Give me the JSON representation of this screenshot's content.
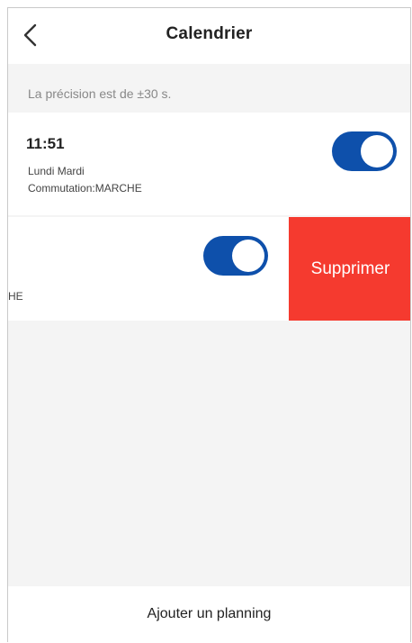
{
  "header": {
    "title": "Calendrier",
    "back_icon": "chevron-left-icon"
  },
  "note": "La précision est de ±30 s.",
  "schedules": [
    {
      "time": "11:51",
      "days": "Lundi Mardi",
      "switching": "Commutation:MARCHE",
      "enabled": true
    },
    {
      "clipped_text": "HE",
      "enabled": true,
      "delete_label": "Supprimer"
    }
  ],
  "footer": {
    "add_label": "Ajouter un planning"
  },
  "colors": {
    "toggle_on": "#0e50ab",
    "delete": "#f53a2f",
    "background": "#f4f4f4"
  }
}
